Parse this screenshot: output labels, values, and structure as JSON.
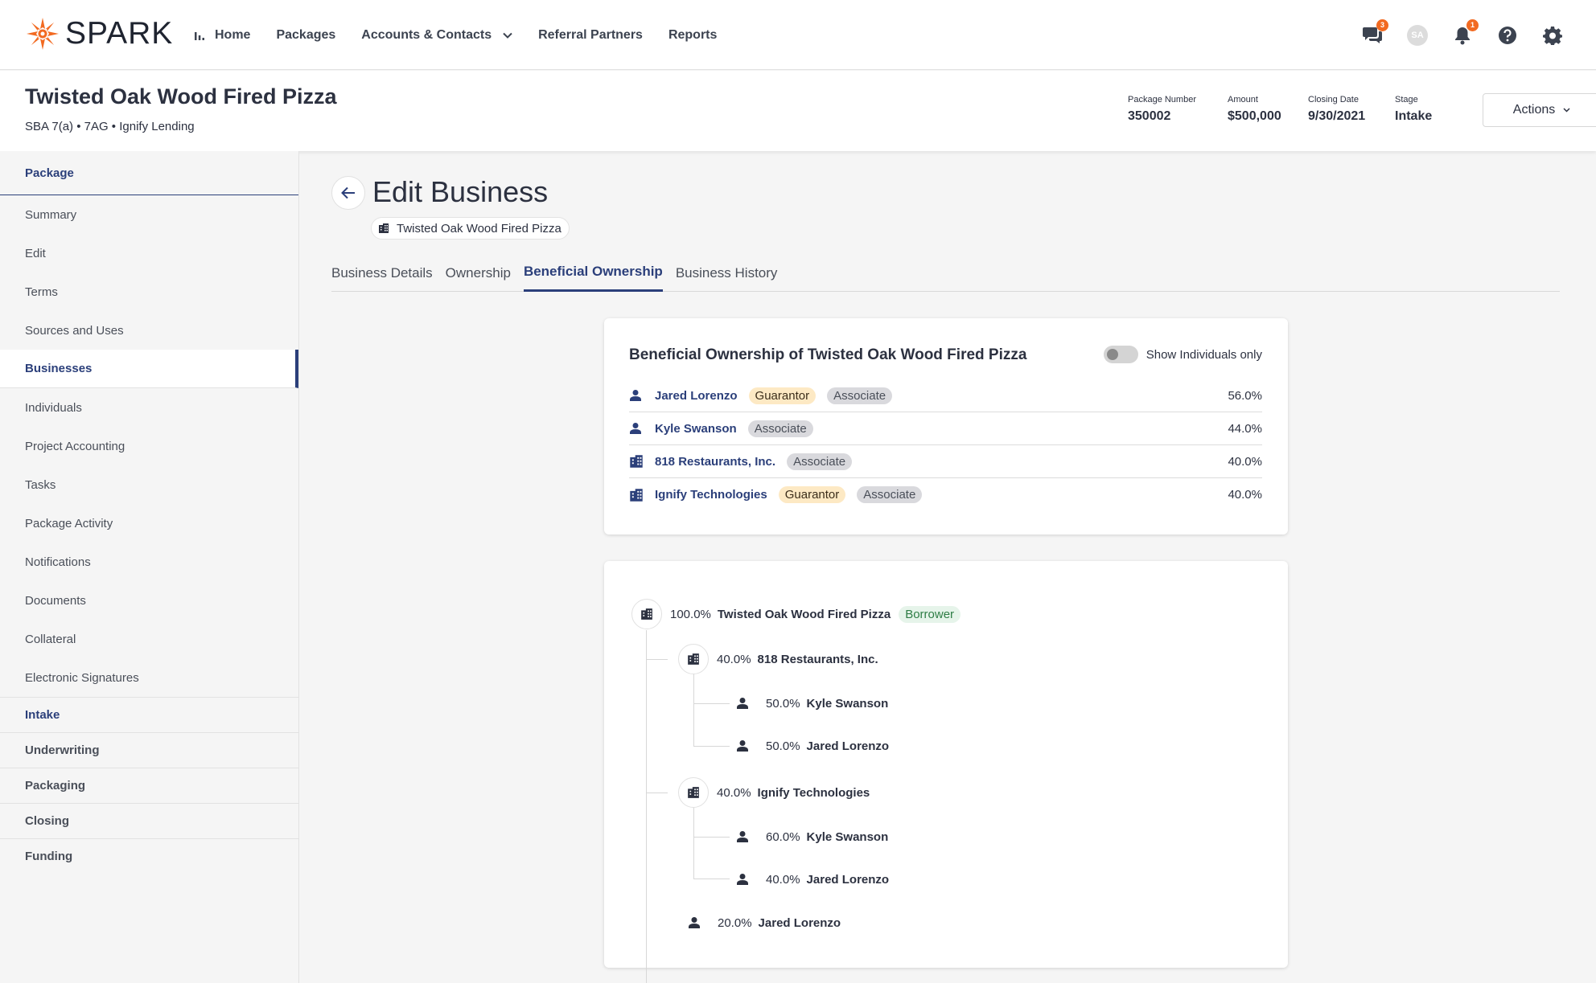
{
  "app": {
    "brand": "SPARK",
    "accent": "#2b3f7a",
    "brand_color": "#f26a21"
  },
  "nav": {
    "items": [
      {
        "label": "Home",
        "icon": "bar-chart-icon"
      },
      {
        "label": "Packages"
      },
      {
        "label": "Accounts & Contacts",
        "dropdown": true
      },
      {
        "label": "Referral Partners"
      },
      {
        "label": "Reports"
      }
    ],
    "right": {
      "chat_badge": "3",
      "avatar_initials": "SA",
      "notifications_badge": "1"
    }
  },
  "header": {
    "title": "Twisted Oak Wood Fired Pizza",
    "subtitle": "SBA 7(a) • 7AG • Ignify Lending",
    "meta": [
      {
        "label": "Package Number",
        "value": "350002"
      },
      {
        "label": "Amount",
        "value": "$500,000"
      },
      {
        "label": "Closing Date",
        "value": "9/30/2021"
      },
      {
        "label": "Stage",
        "value": "Intake"
      }
    ],
    "actions_label": "Actions"
  },
  "sidebar": {
    "section": "Package",
    "items": [
      {
        "label": "Summary"
      },
      {
        "label": "Edit"
      },
      {
        "label": "Terms"
      },
      {
        "label": "Sources and Uses"
      },
      {
        "label": "Businesses",
        "active": true
      },
      {
        "label": "Individuals"
      },
      {
        "label": "Project Accounting"
      },
      {
        "label": "Tasks"
      },
      {
        "label": "Package Activity"
      },
      {
        "label": "Notifications"
      },
      {
        "label": "Documents"
      },
      {
        "label": "Collateral"
      },
      {
        "label": "Electronic Signatures"
      }
    ],
    "groups": [
      {
        "label": "Intake"
      },
      {
        "label": "Underwriting"
      },
      {
        "label": "Packaging"
      },
      {
        "label": "Closing"
      },
      {
        "label": "Funding"
      }
    ]
  },
  "main": {
    "title": "Edit Business",
    "business_chip": "Twisted Oak Wood Fired Pizza",
    "tabs": [
      {
        "label": "Business Details"
      },
      {
        "label": "Ownership"
      },
      {
        "label": "Beneficial Ownership",
        "active": true
      },
      {
        "label": "Business History"
      }
    ],
    "ownership_card": {
      "title": "Beneficial Ownership of Twisted Oak Wood Fired Pizza",
      "toggle_label": "Show Individuals only",
      "rows": [
        {
          "name": "Jared Lorenzo",
          "type": "person",
          "tags": [
            "Guarantor",
            "Associate"
          ],
          "pct": "56.0%"
        },
        {
          "name": "Kyle Swanson",
          "type": "person",
          "tags": [
            "Associate"
          ],
          "pct": "44.0%"
        },
        {
          "name": "818 Restaurants, Inc.",
          "type": "business",
          "tags": [
            "Associate"
          ],
          "pct": "40.0%"
        },
        {
          "name": "Ignify Technologies",
          "type": "business",
          "tags": [
            "Guarantor",
            "Associate"
          ],
          "pct": "40.0%"
        }
      ]
    },
    "tree": {
      "root": {
        "pct": "100.0%",
        "name": "Twisted Oak Wood Fired Pizza",
        "tag": "Borrower"
      },
      "nodes": [
        {
          "pct": "40.0%",
          "name": "818 Restaurants, Inc."
        },
        {
          "pct": "50.0%",
          "name": "Kyle Swanson"
        },
        {
          "pct": "50.0%",
          "name": "Jared Lorenzo"
        },
        {
          "pct": "40.0%",
          "name": "Ignify Technologies"
        },
        {
          "pct": "60.0%",
          "name": "Kyle Swanson"
        },
        {
          "pct": "40.0%",
          "name": "Jared Lorenzo"
        },
        {
          "pct": "20.0%",
          "name": "Jared Lorenzo"
        }
      ]
    }
  }
}
